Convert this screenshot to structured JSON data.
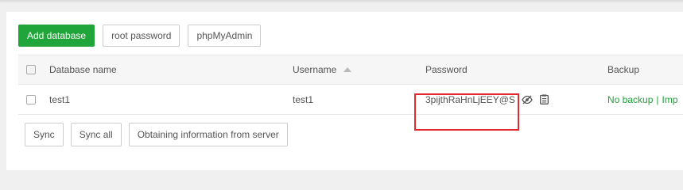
{
  "toolbar": {
    "add_database": "Add database",
    "root_password": "root password",
    "phpmyadmin": "phpMyAdmin"
  },
  "table": {
    "headers": {
      "database_name": "Database name",
      "username": "Username",
      "password": "Password",
      "backup": "Backup"
    },
    "sort_column": "Username",
    "rows": [
      {
        "database_name": "test1",
        "username": "test1",
        "password": "3pijthRaHnLjEEY@S",
        "backup_status": "No backup",
        "backup_separator": "|",
        "import_label": "Imp"
      }
    ]
  },
  "footer": {
    "sync": "Sync",
    "sync_all": "Sync all",
    "obtain_info": "Obtaining information from server"
  },
  "icons": {
    "show_password": "eye-slash-icon",
    "copy_password": "copy-icon",
    "sort": "sort-ascending-icon"
  },
  "colors": {
    "primary": "#20a53a",
    "highlight_box": "#e2282c"
  }
}
